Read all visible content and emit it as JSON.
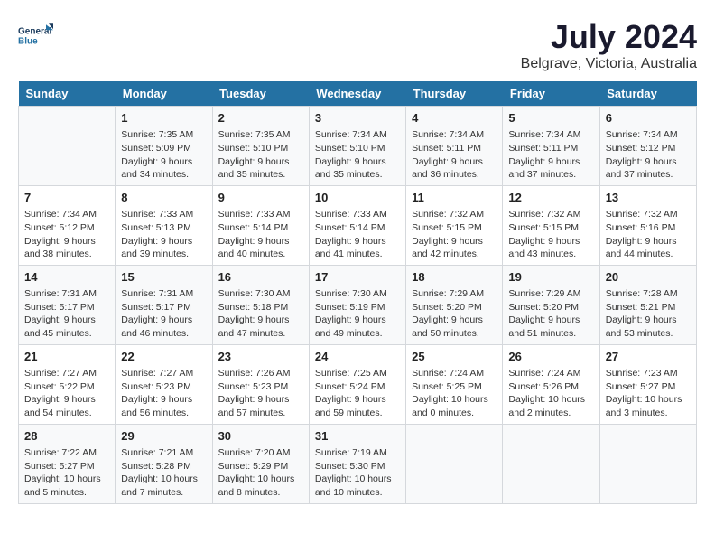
{
  "logo": {
    "line1": "General",
    "line2": "Blue"
  },
  "title": "July 2024",
  "subtitle": "Belgrave, Victoria, Australia",
  "columns": [
    "Sunday",
    "Monday",
    "Tuesday",
    "Wednesday",
    "Thursday",
    "Friday",
    "Saturday"
  ],
  "weeks": [
    [
      {
        "day": "",
        "info": ""
      },
      {
        "day": "1",
        "info": "Sunrise: 7:35 AM\nSunset: 5:09 PM\nDaylight: 9 hours\nand 34 minutes."
      },
      {
        "day": "2",
        "info": "Sunrise: 7:35 AM\nSunset: 5:10 PM\nDaylight: 9 hours\nand 35 minutes."
      },
      {
        "day": "3",
        "info": "Sunrise: 7:34 AM\nSunset: 5:10 PM\nDaylight: 9 hours\nand 35 minutes."
      },
      {
        "day": "4",
        "info": "Sunrise: 7:34 AM\nSunset: 5:11 PM\nDaylight: 9 hours\nand 36 minutes."
      },
      {
        "day": "5",
        "info": "Sunrise: 7:34 AM\nSunset: 5:11 PM\nDaylight: 9 hours\nand 37 minutes."
      },
      {
        "day": "6",
        "info": "Sunrise: 7:34 AM\nSunset: 5:12 PM\nDaylight: 9 hours\nand 37 minutes."
      }
    ],
    [
      {
        "day": "7",
        "info": "Sunrise: 7:34 AM\nSunset: 5:12 PM\nDaylight: 9 hours\nand 38 minutes."
      },
      {
        "day": "8",
        "info": "Sunrise: 7:33 AM\nSunset: 5:13 PM\nDaylight: 9 hours\nand 39 minutes."
      },
      {
        "day": "9",
        "info": "Sunrise: 7:33 AM\nSunset: 5:14 PM\nDaylight: 9 hours\nand 40 minutes."
      },
      {
        "day": "10",
        "info": "Sunrise: 7:33 AM\nSunset: 5:14 PM\nDaylight: 9 hours\nand 41 minutes."
      },
      {
        "day": "11",
        "info": "Sunrise: 7:32 AM\nSunset: 5:15 PM\nDaylight: 9 hours\nand 42 minutes."
      },
      {
        "day": "12",
        "info": "Sunrise: 7:32 AM\nSunset: 5:15 PM\nDaylight: 9 hours\nand 43 minutes."
      },
      {
        "day": "13",
        "info": "Sunrise: 7:32 AM\nSunset: 5:16 PM\nDaylight: 9 hours\nand 44 minutes."
      }
    ],
    [
      {
        "day": "14",
        "info": "Sunrise: 7:31 AM\nSunset: 5:17 PM\nDaylight: 9 hours\nand 45 minutes."
      },
      {
        "day": "15",
        "info": "Sunrise: 7:31 AM\nSunset: 5:17 PM\nDaylight: 9 hours\nand 46 minutes."
      },
      {
        "day": "16",
        "info": "Sunrise: 7:30 AM\nSunset: 5:18 PM\nDaylight: 9 hours\nand 47 minutes."
      },
      {
        "day": "17",
        "info": "Sunrise: 7:30 AM\nSunset: 5:19 PM\nDaylight: 9 hours\nand 49 minutes."
      },
      {
        "day": "18",
        "info": "Sunrise: 7:29 AM\nSunset: 5:20 PM\nDaylight: 9 hours\nand 50 minutes."
      },
      {
        "day": "19",
        "info": "Sunrise: 7:29 AM\nSunset: 5:20 PM\nDaylight: 9 hours\nand 51 minutes."
      },
      {
        "day": "20",
        "info": "Sunrise: 7:28 AM\nSunset: 5:21 PM\nDaylight: 9 hours\nand 53 minutes."
      }
    ],
    [
      {
        "day": "21",
        "info": "Sunrise: 7:27 AM\nSunset: 5:22 PM\nDaylight: 9 hours\nand 54 minutes."
      },
      {
        "day": "22",
        "info": "Sunrise: 7:27 AM\nSunset: 5:23 PM\nDaylight: 9 hours\nand 56 minutes."
      },
      {
        "day": "23",
        "info": "Sunrise: 7:26 AM\nSunset: 5:23 PM\nDaylight: 9 hours\nand 57 minutes."
      },
      {
        "day": "24",
        "info": "Sunrise: 7:25 AM\nSunset: 5:24 PM\nDaylight: 9 hours\nand 59 minutes."
      },
      {
        "day": "25",
        "info": "Sunrise: 7:24 AM\nSunset: 5:25 PM\nDaylight: 10 hours\nand 0 minutes."
      },
      {
        "day": "26",
        "info": "Sunrise: 7:24 AM\nSunset: 5:26 PM\nDaylight: 10 hours\nand 2 minutes."
      },
      {
        "day": "27",
        "info": "Sunrise: 7:23 AM\nSunset: 5:27 PM\nDaylight: 10 hours\nand 3 minutes."
      }
    ],
    [
      {
        "day": "28",
        "info": "Sunrise: 7:22 AM\nSunset: 5:27 PM\nDaylight: 10 hours\nand 5 minutes."
      },
      {
        "day": "29",
        "info": "Sunrise: 7:21 AM\nSunset: 5:28 PM\nDaylight: 10 hours\nand 7 minutes."
      },
      {
        "day": "30",
        "info": "Sunrise: 7:20 AM\nSunset: 5:29 PM\nDaylight: 10 hours\nand 8 minutes."
      },
      {
        "day": "31",
        "info": "Sunrise: 7:19 AM\nSunset: 5:30 PM\nDaylight: 10 hours\nand 10 minutes."
      },
      {
        "day": "",
        "info": ""
      },
      {
        "day": "",
        "info": ""
      },
      {
        "day": "",
        "info": ""
      }
    ]
  ]
}
